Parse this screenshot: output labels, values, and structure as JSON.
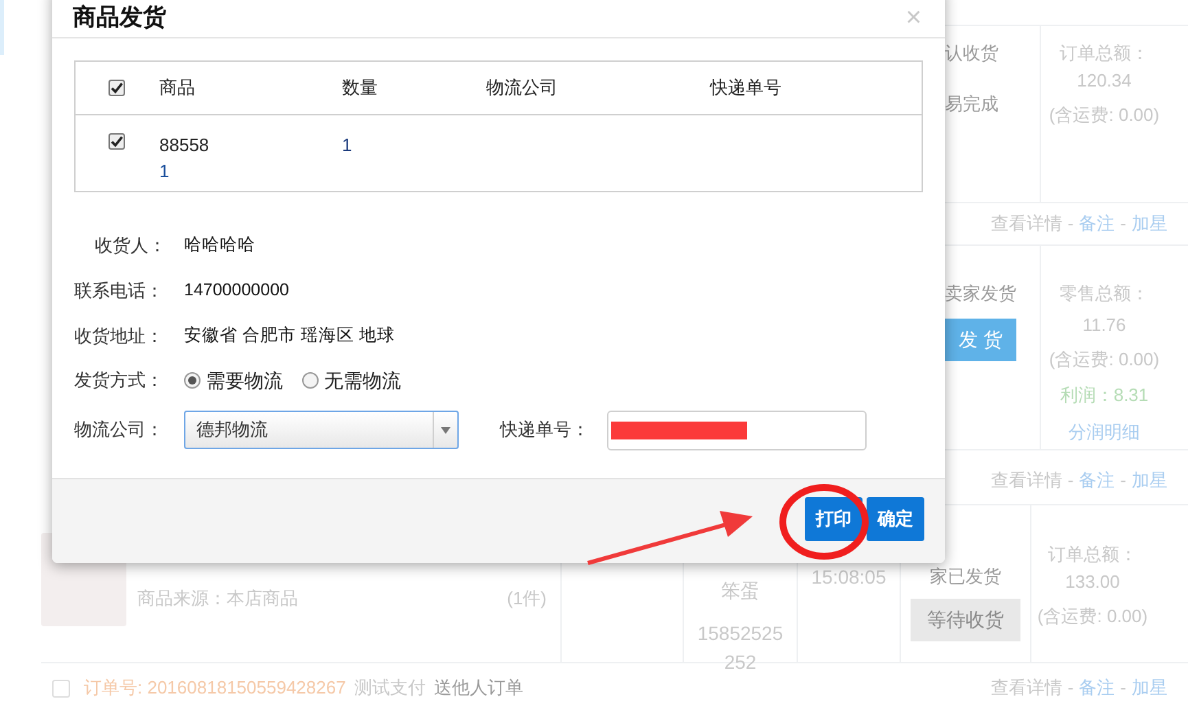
{
  "background": {
    "order_1": {
      "status_lines": [
        "认收货",
        "易完成"
      ],
      "amount_label": "订单总额：",
      "amount": "120.34",
      "shipping": "(含运费: 0.00)"
    },
    "links_1": [
      {
        "kind": "link",
        "text": "查看详情"
      },
      {
        "kind": "separator",
        "text": "-"
      },
      {
        "kind": "link",
        "text": "备注"
      },
      {
        "kind": "separator",
        "text": "-"
      },
      {
        "kind": "link",
        "text": "加星"
      }
    ],
    "order_2": {
      "status": "卖家发货",
      "button": "发 货",
      "amount_label": "零售总额：",
      "amount": "11.76",
      "shipping": "(含运费: 0.00)",
      "profit": "利润：8.31",
      "detail_link": "分润明细"
    },
    "links_2": [
      {
        "kind": "link",
        "text": "查看详情"
      },
      {
        "kind": "separator",
        "text": "-"
      },
      {
        "kind": "link",
        "text": "备注"
      },
      {
        "kind": "separator",
        "text": "-"
      },
      {
        "kind": "link",
        "text": "加星"
      }
    ],
    "order_3": {
      "source": "商品来源：本店商品",
      "quantity": "(1件)",
      "buyer_name": "笨蛋",
      "buyer_phone": [
        "15852525",
        "252"
      ],
      "time": "15:08:05",
      "status": "家已发货",
      "button": "等待收货",
      "amount_label": "订单总额：",
      "amount": "133.00",
      "shipping": "(含运费: 0.00)"
    },
    "order_4": {
      "checked": false,
      "order_no": "订单号: 20160818150559428267",
      "payment": "测试支付",
      "type": "送他人订单"
    },
    "links_4": [
      {
        "kind": "link",
        "text": "查看详情"
      },
      {
        "kind": "separator",
        "text": "-"
      },
      {
        "kind": "link",
        "text": "备注"
      },
      {
        "kind": "separator",
        "text": "-"
      },
      {
        "kind": "link",
        "text": "加星"
      }
    ]
  },
  "dialog": {
    "title": "商品发货",
    "close": "×",
    "table": {
      "header_checked": true,
      "columns": [
        "商品",
        "数量",
        "物流公司",
        "快递单号"
      ],
      "rows": [
        {
          "checked": true,
          "product": [
            "88558",
            "1"
          ],
          "quantity": "1"
        }
      ]
    },
    "fields": [
      {
        "label": "收货人：",
        "value": "哈哈哈哈"
      },
      {
        "label": "联系电话：",
        "value": "14700000000"
      },
      {
        "label": "收货地址：",
        "value": "安徽省 合肥市 瑶海区 地球"
      }
    ],
    "shipping_method": {
      "label": "发货方式：",
      "options": [
        {
          "label": "需要物流",
          "selected": true
        },
        {
          "label": "无需物流",
          "selected": false
        }
      ]
    },
    "carrier": {
      "label": "物流公司：",
      "value": "德邦物流"
    },
    "tracking": {
      "label": "快递单号：",
      "redacted": true
    },
    "buttons": [
      "打印",
      "确定"
    ]
  }
}
